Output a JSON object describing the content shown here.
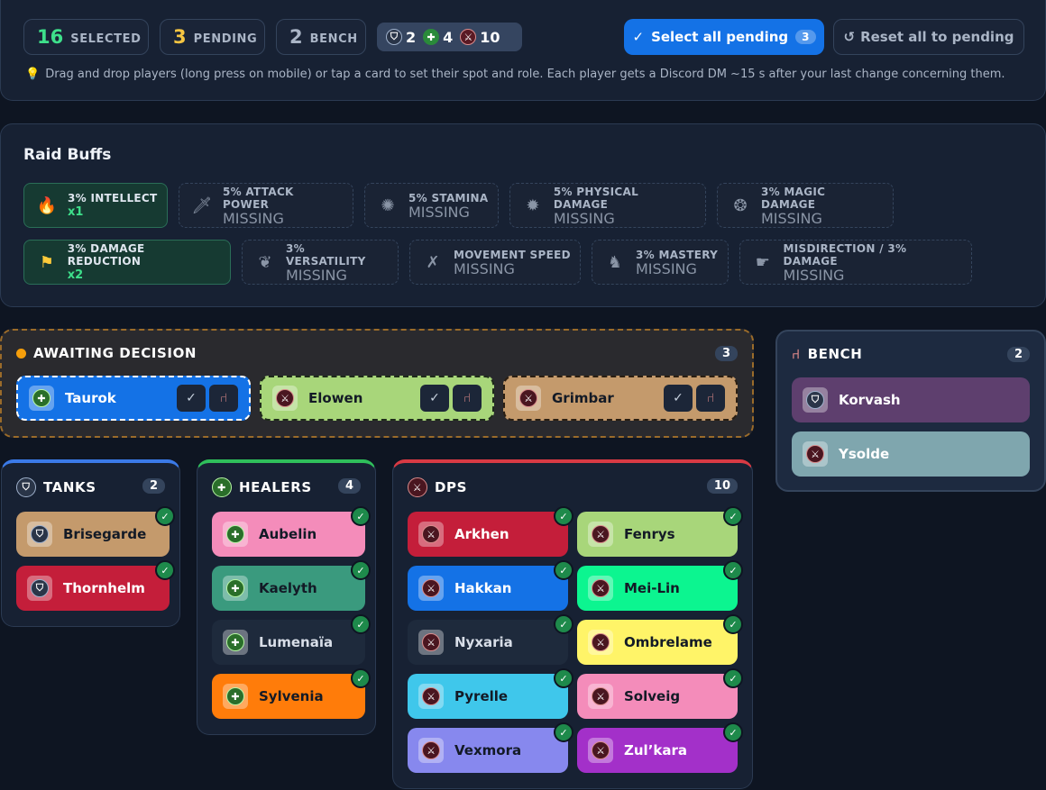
{
  "summary": {
    "selected": {
      "num": "16",
      "label": "SELECTED"
    },
    "pending": {
      "num": "3",
      "label": "PENDING"
    },
    "bench": {
      "num": "2",
      "label": "BENCH"
    },
    "role_counts": {
      "tanks": "2",
      "healers": "4",
      "dps": "10"
    },
    "select_all_label": "Select all pending",
    "select_all_count": "3",
    "reset_label": "Reset all to pending",
    "hint": "Drag and drop players (long press on mobile) or tap a card to set their spot and role. Each player gets a Discord DM ~15 s after your last change concerning them."
  },
  "buffs": {
    "title": "Raid Buffs",
    "row1": [
      {
        "name": "3% INTELLECT",
        "value": "x1",
        "ok": true,
        "icon": "flame-icon"
      },
      {
        "name": "5% ATTACK POWER",
        "value": "MISSING",
        "ok": false,
        "icon": "sword-icon"
      },
      {
        "name": "5% STAMINA",
        "value": "MISSING",
        "ok": false,
        "icon": "scroll-icon"
      },
      {
        "name": "5% PHYSICAL DAMAGE",
        "value": "MISSING",
        "ok": false,
        "icon": "burst-icon"
      },
      {
        "name": "3% MAGIC DAMAGE",
        "value": "MISSING",
        "ok": false,
        "icon": "swirl-icon"
      }
    ],
    "row2": [
      {
        "name": "3% DAMAGE REDUCTION",
        "value": "x2",
        "ok": true,
        "icon": "banner-icon"
      },
      {
        "name": "3% VERSATILITY",
        "value": "MISSING",
        "ok": false,
        "icon": "paw-icon"
      },
      {
        "name": "MOVEMENT SPEED",
        "value": "MISSING",
        "ok": false,
        "icon": "daggers-icon"
      },
      {
        "name": "3% MASTERY",
        "value": "MISSING",
        "ok": false,
        "icon": "wolf-icon"
      },
      {
        "name": "MISDIRECTION / 3% DAMAGE",
        "value": "MISSING",
        "ok": false,
        "icon": "hand-icon"
      }
    ]
  },
  "awaiting": {
    "title": "AWAITING DECISION",
    "count": "3",
    "players": [
      "Taurok",
      "Elowen",
      "Grimbar"
    ]
  },
  "bench_group": {
    "title": "BENCH",
    "count": "2",
    "players": [
      "Korvash",
      "Ysolde"
    ]
  },
  "tanks": {
    "title": "TANKS",
    "count": "2",
    "players": [
      "Brisegarde",
      "Thornhelm"
    ]
  },
  "healers": {
    "title": "HEALERS",
    "count": "4",
    "players": [
      "Aubelin",
      "Kaelyth",
      "Lumenaïa",
      "Sylvenia"
    ]
  },
  "dps": {
    "title": "DPS",
    "count": "10",
    "players": [
      "Arkhen",
      "Fenrys",
      "Hakkan",
      "Mei-Lin",
      "Nyxaria",
      "Ombrelame",
      "Pyrelle",
      "Solveig",
      "Vexmora",
      "Zul’kara"
    ]
  },
  "colors": {
    "accent": "#1472e6",
    "ok_green": "#3ee08b",
    "tank": "#3b7ae8",
    "healer": "#2fbf5b",
    "dps": "#d93a44",
    "pending_border": "#9a6b2a"
  }
}
